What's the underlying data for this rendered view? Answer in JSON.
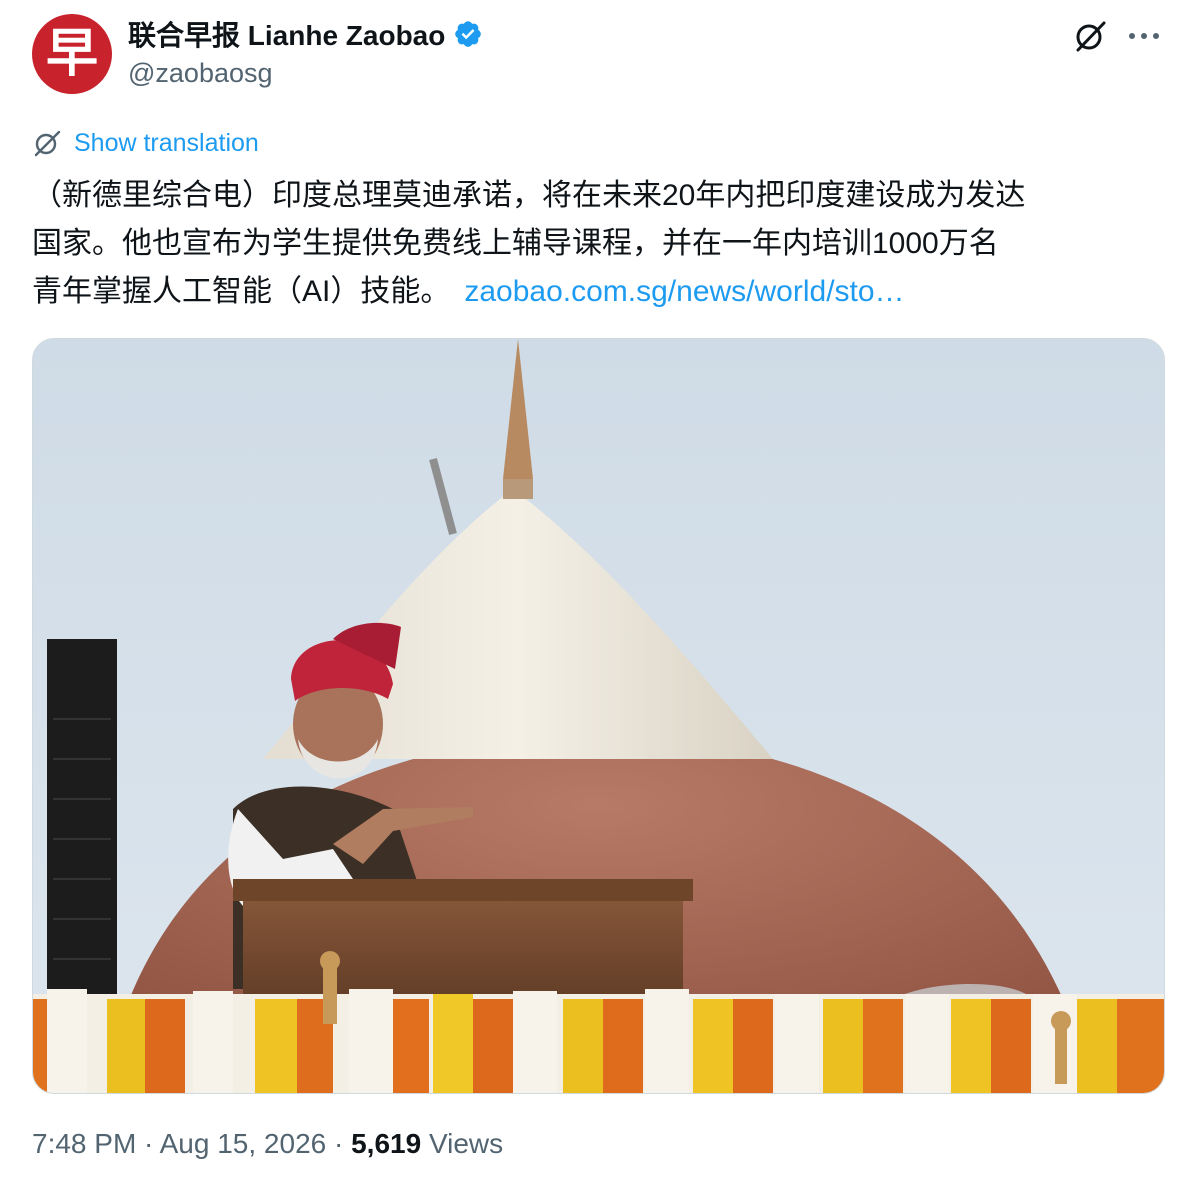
{
  "account": {
    "avatar_glyph": "早",
    "display_name": "联合早报 Lianhe Zaobao",
    "handle": "@zaobaosg",
    "verified": true
  },
  "actions": {
    "grok_icon": "grok-icon",
    "more_icon": "more-icon"
  },
  "translation": {
    "label": "Show translation"
  },
  "tweet": {
    "line1": "（新德里综合电）印度总理莫迪承诺，将在未来20年内把印度建设成为发达",
    "line2": "国家。他也宣布为学生提供免费线上辅导课程，并在一年内培训1000万名",
    "line3": "青年掌握人工智能（AI）技能。",
    "link": "zaobao.com.sg/news/world/sto…"
  },
  "meta": {
    "time": "7:48 PM",
    "separator": " · ",
    "date": "Aug 15, 2026",
    "views_count": "5,619",
    "views_label": "Views"
  },
  "colors": {
    "accent": "#1d9bf0",
    "text": "#0f1419",
    "muted": "#536471",
    "avatar_bg": "#c8232c"
  }
}
